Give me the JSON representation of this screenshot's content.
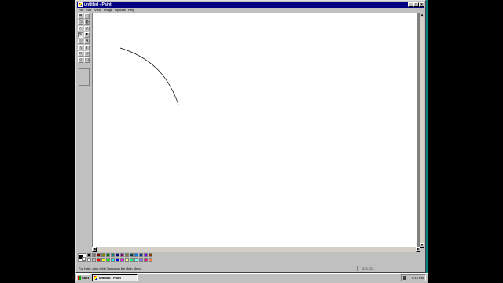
{
  "window": {
    "title": "untitled - Paint",
    "controls": {
      "minimize": "_",
      "maximize": "□",
      "close": "×"
    }
  },
  "menu": [
    "File",
    "Edit",
    "View",
    "Image",
    "Options",
    "Help"
  ],
  "tools": [
    {
      "name": "free-form-select-icon",
      "glyph": "⌗"
    },
    {
      "name": "rect-select-icon",
      "glyph": "⬚"
    },
    {
      "name": "eraser-icon",
      "glyph": "▭"
    },
    {
      "name": "fill-icon",
      "glyph": "◍"
    },
    {
      "name": "color-picker-icon",
      "glyph": "⁄"
    },
    {
      "name": "magnifier-icon",
      "glyph": "⚲"
    },
    {
      "name": "pencil-icon",
      "glyph": "✎"
    },
    {
      "name": "brush-icon",
      "glyph": "♜"
    },
    {
      "name": "airbrush-icon",
      "glyph": "░"
    },
    {
      "name": "text-icon",
      "glyph": "A"
    },
    {
      "name": "line-icon",
      "glyph": "╲"
    },
    {
      "name": "curve-icon",
      "glyph": "∫"
    },
    {
      "name": "rectangle-icon",
      "glyph": "□"
    },
    {
      "name": "polygon-icon",
      "glyph": "⬠"
    },
    {
      "name": "ellipse-icon",
      "glyph": "○"
    },
    {
      "name": "rounded-rect-icon",
      "glyph": "▢"
    }
  ],
  "active_tool": "pencil-icon",
  "palette": {
    "foreground": "#000000",
    "background": "#ffffff",
    "colors": [
      "#000000",
      "#808080",
      "#800000",
      "#808000",
      "#008000",
      "#008080",
      "#000080",
      "#800080",
      "#808040",
      "#004040",
      "#0080ff",
      "#004080",
      "#8000ff",
      "#804000",
      "#ffffff",
      "#c0c0c0",
      "#ff0000",
      "#ffff00",
      "#00ff00",
      "#00ffff",
      "#0000ff",
      "#ff00ff",
      "#ffff80",
      "#00ff80",
      "#80ffff",
      "#8080ff",
      "#ff0080",
      "#ff8040"
    ]
  },
  "status": {
    "help_text": "For Help, click Help Topics on the Help Menu.",
    "coordinates": "315,222"
  },
  "taskbar": {
    "start_label": "Start",
    "task_label": "untitled - Paint",
    "clock": "8:13 PM"
  }
}
